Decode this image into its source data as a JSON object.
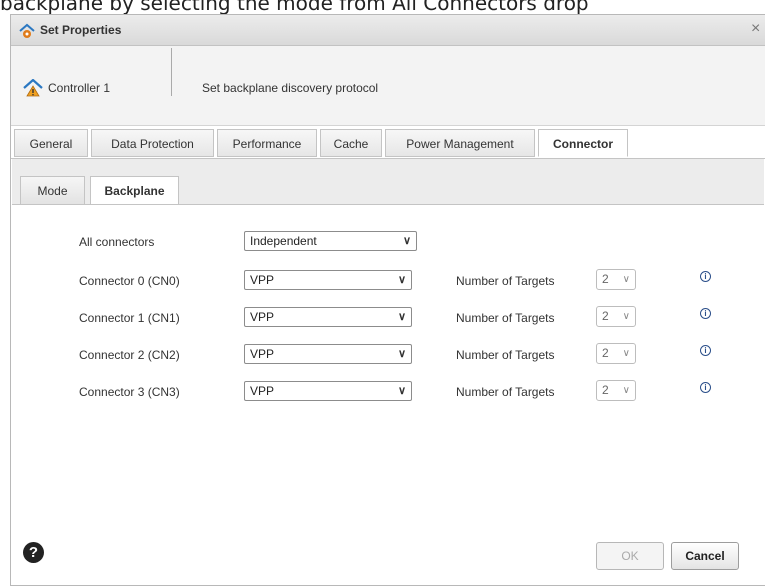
{
  "background_text": "backplane by selecting the mode from All Connectors drop",
  "dialog": {
    "title": "Set Properties",
    "close_glyph": "×"
  },
  "header": {
    "controller": "Controller 1",
    "description": "Set backplane discovery protocol"
  },
  "tabs": [
    {
      "label": "General",
      "active": false
    },
    {
      "label": "Data Protection",
      "active": false
    },
    {
      "label": "Performance",
      "active": false
    },
    {
      "label": "Cache",
      "active": false
    },
    {
      "label": "Power Management",
      "active": false
    },
    {
      "label": "Connector",
      "active": true
    }
  ],
  "subtabs": [
    {
      "label": "Mode",
      "active": false
    },
    {
      "label": "Backplane",
      "active": true
    }
  ],
  "all_connectors": {
    "label": "All connectors",
    "value": "Independent"
  },
  "connectors": [
    {
      "label": "Connector 0 (CN0)",
      "mode": "VPP",
      "targets_label": "Number of Targets",
      "targets": "2"
    },
    {
      "label": "Connector 1 (CN1)",
      "mode": "VPP",
      "targets_label": "Number of Targets",
      "targets": "2"
    },
    {
      "label": "Connector 2 (CN2)",
      "mode": "VPP",
      "targets_label": "Number of Targets",
      "targets": "2"
    },
    {
      "label": "Connector 3 (CN3)",
      "mode": "VPP",
      "targets_label": "Number of Targets",
      "targets": "2"
    }
  ],
  "icons": {
    "chevron": "∨",
    "info": "i",
    "help": "?"
  },
  "footer": {
    "ok_label": "OK",
    "cancel_label": "Cancel"
  }
}
